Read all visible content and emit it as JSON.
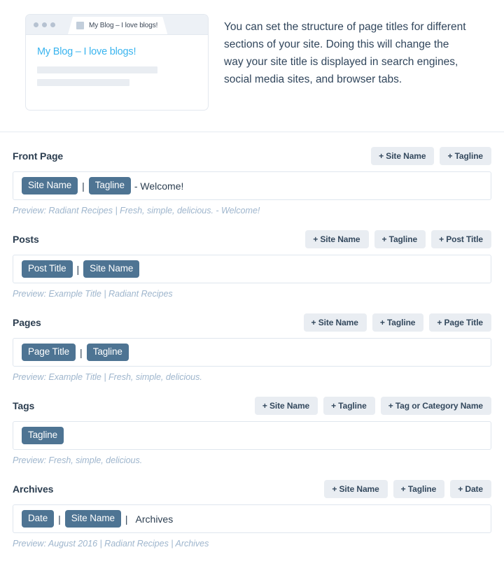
{
  "intro": {
    "browser_mock": {
      "tab_title": "My Blog – I love blogs!",
      "page_heading": "My Blog – I love blogs!",
      "favicon": "placeholder-favicon-icon",
      "dots": [
        "window-dot-1",
        "window-dot-2",
        "window-dot-3"
      ]
    },
    "description": "You can set the structure of page titles for different sections of your site. Doing this will change the way your site title is displayed in search engines, social media sites, and browser tabs."
  },
  "colors": {
    "chip_bg": "#4e7493",
    "button_bg": "#e9edf2",
    "link_blue": "#39b4ef",
    "preview_text": "#9fb6cd",
    "heading": "#2c3e50"
  },
  "sections": [
    {
      "title": "Front Page",
      "buttons": [
        "+ Site Name",
        "+ Tagline"
      ],
      "tokens": [
        {
          "type": "chip",
          "text": "Site Name"
        },
        {
          "type": "sep",
          "text": "|"
        },
        {
          "type": "chip",
          "text": "Tagline"
        },
        {
          "type": "plain",
          "text": "- Welcome!"
        }
      ],
      "preview": "Preview: Radiant Recipes | Fresh, simple, delicious. - Welcome!"
    },
    {
      "title": "Posts",
      "buttons": [
        "+ Site Name",
        "+ Tagline",
        "+ Post Title"
      ],
      "tokens": [
        {
          "type": "chip",
          "text": "Post Title"
        },
        {
          "type": "sep",
          "text": "|"
        },
        {
          "type": "chip",
          "text": "Site Name"
        }
      ],
      "preview": "Preview: Example Title | Radiant Recipes"
    },
    {
      "title": "Pages",
      "buttons": [
        "+ Site Name",
        "+ Tagline",
        "+ Page Title"
      ],
      "tokens": [
        {
          "type": "chip",
          "text": "Page Title"
        },
        {
          "type": "sep",
          "text": "|"
        },
        {
          "type": "chip",
          "text": "Tagline"
        }
      ],
      "preview": "Preview: Example Title | Fresh, simple, delicious."
    },
    {
      "title": "Tags",
      "buttons": [
        "+ Site Name",
        "+ Tagline",
        "+ Tag or Category Name"
      ],
      "tokens": [
        {
          "type": "chip",
          "text": "Tagline"
        }
      ],
      "preview": "Preview: Fresh, simple, delicious."
    },
    {
      "title": "Archives",
      "buttons": [
        "+ Site Name",
        "+ Tagline",
        "+ Date"
      ],
      "tokens": [
        {
          "type": "chip",
          "text": "Date"
        },
        {
          "type": "sep",
          "text": "|"
        },
        {
          "type": "chip",
          "text": "Site Name"
        },
        {
          "type": "sep",
          "text": "|"
        },
        {
          "type": "plain",
          "text": "Archives"
        }
      ],
      "preview": "Preview: August 2016 | Radiant Recipes | Archives"
    }
  ]
}
